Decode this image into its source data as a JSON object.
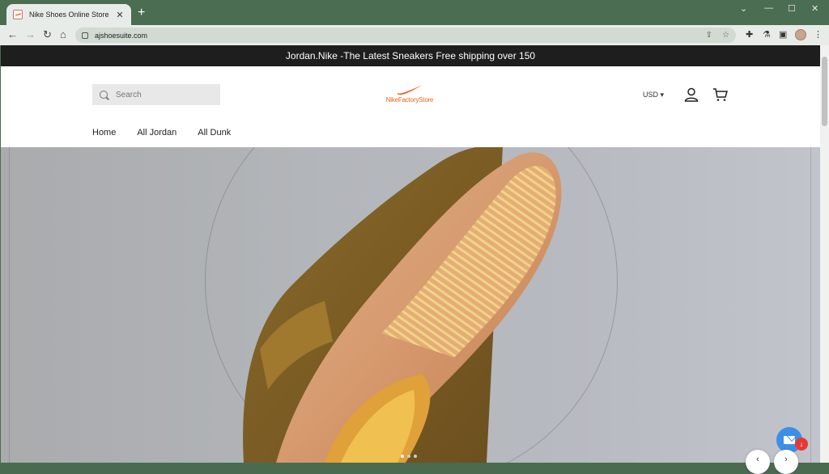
{
  "browser": {
    "tab_title": "Nike Shoes Online Store",
    "tab_close": "✕",
    "new_tab": "+",
    "url": "ajshoesuite.com",
    "window_controls": [
      "⌄",
      "—",
      "☐",
      "✕"
    ]
  },
  "announcement": "Jordan.Nike -The Latest Sneakers Free shipping over 150",
  "header": {
    "search_placeholder": "Search",
    "logo_text": "NikeFactoryStore",
    "currency": "USD"
  },
  "menu": [
    "Home",
    "All Jordan",
    "All Dunk"
  ],
  "carousel": {
    "slides": 3,
    "active": 1
  },
  "colors": {
    "brand_orange": "#e8641e",
    "chrome_green": "#4b6d52",
    "fab_blue": "#3d8fe6"
  }
}
